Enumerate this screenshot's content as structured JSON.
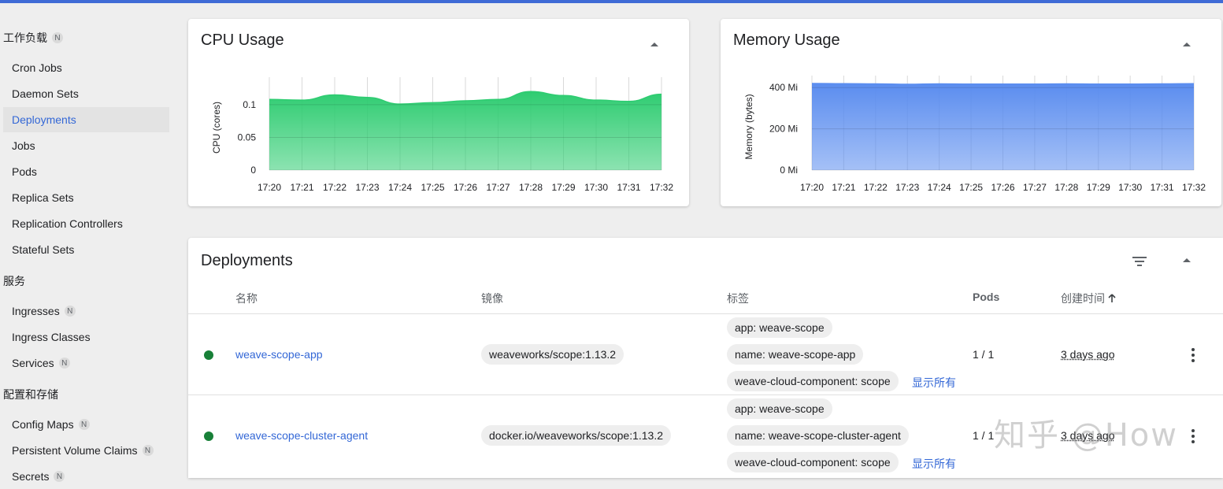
{
  "sidebar": {
    "sections": [
      {
        "title": "工作负载",
        "badge": "N",
        "items": [
          {
            "label": "Cron Jobs",
            "badge": null,
            "active": false
          },
          {
            "label": "Daemon Sets",
            "badge": null,
            "active": false
          },
          {
            "label": "Deployments",
            "badge": null,
            "active": true
          },
          {
            "label": "Jobs",
            "badge": null,
            "active": false
          },
          {
            "label": "Pods",
            "badge": null,
            "active": false
          },
          {
            "label": "Replica Sets",
            "badge": null,
            "active": false
          },
          {
            "label": "Replication Controllers",
            "badge": null,
            "active": false
          },
          {
            "label": "Stateful Sets",
            "badge": null,
            "active": false
          }
        ]
      },
      {
        "title": "服务",
        "badge": null,
        "items": [
          {
            "label": "Ingresses",
            "badge": "N",
            "active": false
          },
          {
            "label": "Ingress Classes",
            "badge": null,
            "active": false
          },
          {
            "label": "Services",
            "badge": "N",
            "active": false
          }
        ]
      },
      {
        "title": "配置和存储",
        "badge": null,
        "items": [
          {
            "label": "Config Maps",
            "badge": "N",
            "active": false
          },
          {
            "label": "Persistent Volume Claims",
            "badge": "N",
            "active": false
          },
          {
            "label": "Secrets",
            "badge": "N",
            "active": false
          }
        ]
      }
    ]
  },
  "cpu_card": {
    "title": "CPU Usage"
  },
  "memory_card": {
    "title": "Memory Usage"
  },
  "chart_data": [
    {
      "type": "area",
      "title": "CPU Usage",
      "ylabel": "CPU (cores)",
      "xlabel": "",
      "x": [
        "17:20",
        "17:21",
        "17:22",
        "17:23",
        "17:24",
        "17:25",
        "17:26",
        "17:27",
        "17:28",
        "17:29",
        "17:30",
        "17:31",
        "17:32"
      ],
      "yticks": [
        "0",
        "0.05",
        "0.1"
      ],
      "ylim": [
        0,
        0.13
      ],
      "values": [
        0.108,
        0.107,
        0.115,
        0.111,
        0.101,
        0.103,
        0.106,
        0.108,
        0.12,
        0.114,
        0.107,
        0.105,
        0.116
      ],
      "color": "#2ecc71",
      "grid": true
    },
    {
      "type": "area",
      "title": "Memory Usage",
      "ylabel": "Memory (bytes)",
      "xlabel": "",
      "x": [
        "17:20",
        "17:21",
        "17:22",
        "17:23",
        "17:24",
        "17:25",
        "17:26",
        "17:27",
        "17:28",
        "17:29",
        "17:30",
        "17:31",
        "17:32"
      ],
      "yticks": [
        "0 Mi",
        "200 Mi",
        "400 Mi"
      ],
      "ylim": [
        0,
        420
      ],
      "values": [
        420,
        419,
        418,
        416,
        418,
        417,
        417,
        417,
        418,
        417,
        417,
        418,
        419
      ],
      "color": "#5b8def",
      "grid": true
    }
  ],
  "deployments": {
    "title": "Deployments",
    "columns": [
      "名称",
      "镜像",
      "标签",
      "Pods",
      "创建时间"
    ],
    "show_all_label": "显示所有",
    "rows": [
      {
        "name": "weave-scope-app",
        "image": "weaveworks/scope:1.13.2",
        "labels": [
          "app: weave-scope",
          "name: weave-scope-app",
          "weave-cloud-component: scope"
        ],
        "pods": "1 / 1",
        "created": "3 days ago"
      },
      {
        "name": "weave-scope-cluster-agent",
        "image": "docker.io/weaveworks/scope:1.13.2",
        "labels": [
          "app: weave-scope",
          "name: weave-scope-cluster-agent",
          "weave-cloud-component: scope"
        ],
        "pods": "1 / 1",
        "created": "3 days ago"
      }
    ]
  },
  "watermark": "知乎 @How"
}
